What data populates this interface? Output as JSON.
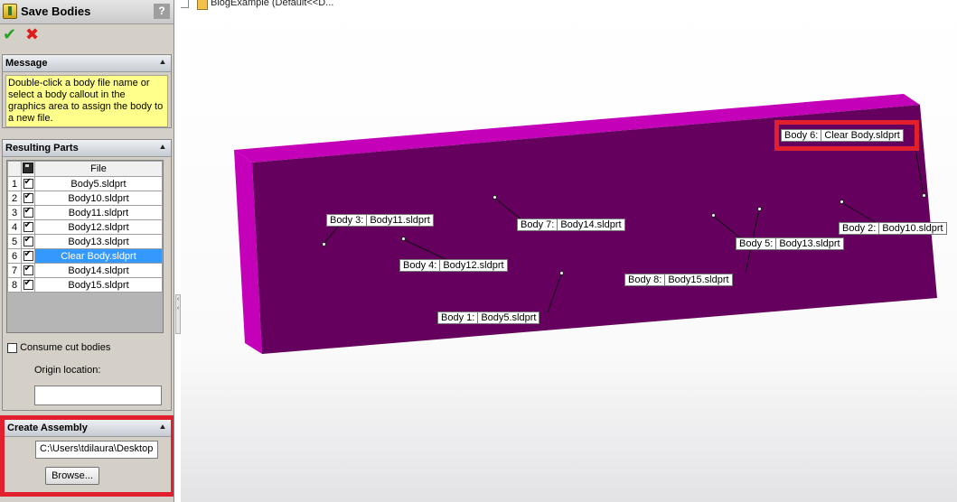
{
  "window": {
    "title": "Save Bodies",
    "help": "?"
  },
  "actions": {
    "ok": "✔",
    "cancel": "✖"
  },
  "message": {
    "header": "Message",
    "text": "Double-click a body file name or select a body callout in the graphics area to assign the body to a new file."
  },
  "resulting_parts": {
    "header": "Resulting Parts",
    "column_file": "File",
    "rows": [
      {
        "num": "1",
        "checked": true,
        "file": "Body5.sldprt"
      },
      {
        "num": "2",
        "checked": true,
        "file": "Body10.sldprt"
      },
      {
        "num": "3",
        "checked": true,
        "file": "Body11.sldprt"
      },
      {
        "num": "4",
        "checked": true,
        "file": "Body12.sldprt"
      },
      {
        "num": "5",
        "checked": true,
        "file": "Body13.sldprt"
      },
      {
        "num": "6",
        "checked": true,
        "file": "Clear Body.sldprt",
        "selected": true
      },
      {
        "num": "7",
        "checked": true,
        "file": "Body14.sldprt"
      },
      {
        "num": "8",
        "checked": true,
        "file": "Body15.sldprt"
      }
    ],
    "consume_cut_bodies": "Consume cut bodies",
    "origin_location": "Origin location:",
    "origin_value": ""
  },
  "create_assembly": {
    "header": "Create Assembly",
    "path": "C:\\Users\\tdilaura\\Desktop",
    "browse": "Browse..."
  },
  "tree": {
    "label": "BlogExample  (Default<<D..."
  },
  "callouts": [
    {
      "id": "Body  6:",
      "file": "Clear Body.sldprt"
    },
    {
      "id": "Body  3:",
      "file": "Body11.sldprt"
    },
    {
      "id": "Body  7:",
      "file": "Body14.sldprt"
    },
    {
      "id": "Body  2:",
      "file": "Body10.sldprt"
    },
    {
      "id": "Body  5:",
      "file": "Body13.sldprt"
    },
    {
      "id": "Body  4:",
      "file": "Body12.sldprt"
    },
    {
      "id": "Body  8:",
      "file": "Body15.sldprt"
    },
    {
      "id": "Body  1:",
      "file": "Body5.sldprt"
    }
  ],
  "colors": {
    "body_face": "#66005f",
    "body_top": "#c400b8",
    "highlight": "#e21f2c",
    "message_bg": "#ffff8c",
    "selection": "#3399ff"
  }
}
